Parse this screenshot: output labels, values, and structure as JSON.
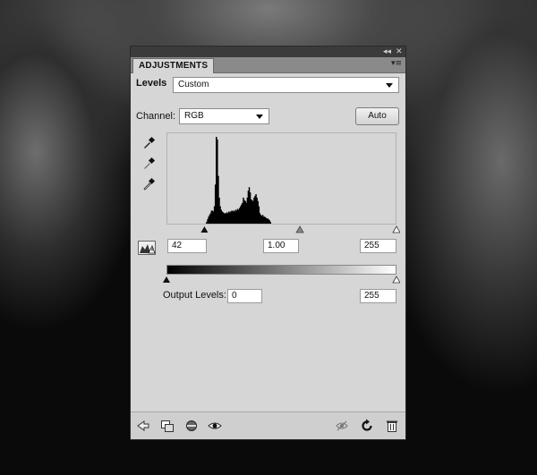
{
  "panel": {
    "tab_label": "ADJUSTMENTS",
    "titlebar_collapse": "◂◂",
    "titlebar_close": "✕",
    "menu_icon": "▾≡"
  },
  "levels": {
    "label": "Levels",
    "preset_value": "Custom",
    "channel_label": "Channel:",
    "channel_value": "RGB",
    "auto_label": "Auto"
  },
  "input_levels": {
    "black": "42",
    "gamma": "1.00",
    "white": "255",
    "black_pos": 0.165,
    "gamma_pos": 0.58,
    "white_pos": 1.0
  },
  "output_levels": {
    "label": "Output Levels:",
    "black": "0",
    "white": "255"
  },
  "chart_data": {
    "type": "area",
    "x_range": [
      0,
      255
    ],
    "values": [
      0,
      0,
      0,
      0,
      0,
      0,
      0,
      0,
      0,
      0,
      0,
      0,
      0,
      0,
      0,
      0,
      0,
      0,
      0,
      0,
      0,
      0,
      0,
      0,
      0,
      0,
      0,
      0,
      0,
      0,
      0,
      0,
      0,
      0,
      0,
      0,
      0,
      0,
      0,
      0,
      0.02,
      0.05,
      0.08,
      0.1,
      0.12,
      0.15,
      0.15,
      0.14,
      0.2,
      0.45,
      1.0,
      0.97,
      0.55,
      0.3,
      0.2,
      0.16,
      0.14,
      0.13,
      0.12,
      0.12,
      0.12,
      0.13,
      0.12,
      0.14,
      0.13,
      0.14,
      0.15,
      0.14,
      0.15,
      0.14,
      0.16,
      0.15,
      0.17,
      0.16,
      0.18,
      0.2,
      0.22,
      0.24,
      0.3,
      0.27,
      0.26,
      0.24,
      0.3,
      0.38,
      0.42,
      0.36,
      0.28,
      0.27,
      0.26,
      0.3,
      0.32,
      0.34,
      0.3,
      0.26,
      0.2,
      0.12,
      0.1,
      0.09,
      0.1,
      0.08,
      0.08,
      0.07,
      0.06,
      0.06,
      0.05,
      0.04,
      0.02,
      0,
      0,
      0,
      0,
      0,
      0,
      0,
      0,
      0,
      0,
      0,
      0,
      0,
      0,
      0,
      0,
      0,
      0,
      0,
      0,
      0,
      0,
      0,
      0,
      0,
      0,
      0,
      0,
      0,
      0,
      0,
      0,
      0,
      0,
      0,
      0,
      0,
      0,
      0,
      0,
      0,
      0,
      0,
      0,
      0,
      0,
      0,
      0,
      0,
      0,
      0,
      0,
      0,
      0,
      0,
      0,
      0,
      0,
      0,
      0,
      0,
      0,
      0,
      0,
      0,
      0,
      0,
      0,
      0,
      0,
      0,
      0,
      0,
      0,
      0,
      0,
      0,
      0,
      0,
      0,
      0,
      0,
      0,
      0,
      0,
      0,
      0,
      0,
      0,
      0,
      0,
      0,
      0,
      0,
      0,
      0,
      0,
      0,
      0,
      0,
      0,
      0,
      0,
      0,
      0,
      0,
      0,
      0,
      0,
      0,
      0,
      0,
      0,
      0,
      0,
      0,
      0,
      0,
      0,
      0,
      0,
      0,
      0,
      0,
      0,
      0,
      0,
      0,
      0
    ]
  }
}
